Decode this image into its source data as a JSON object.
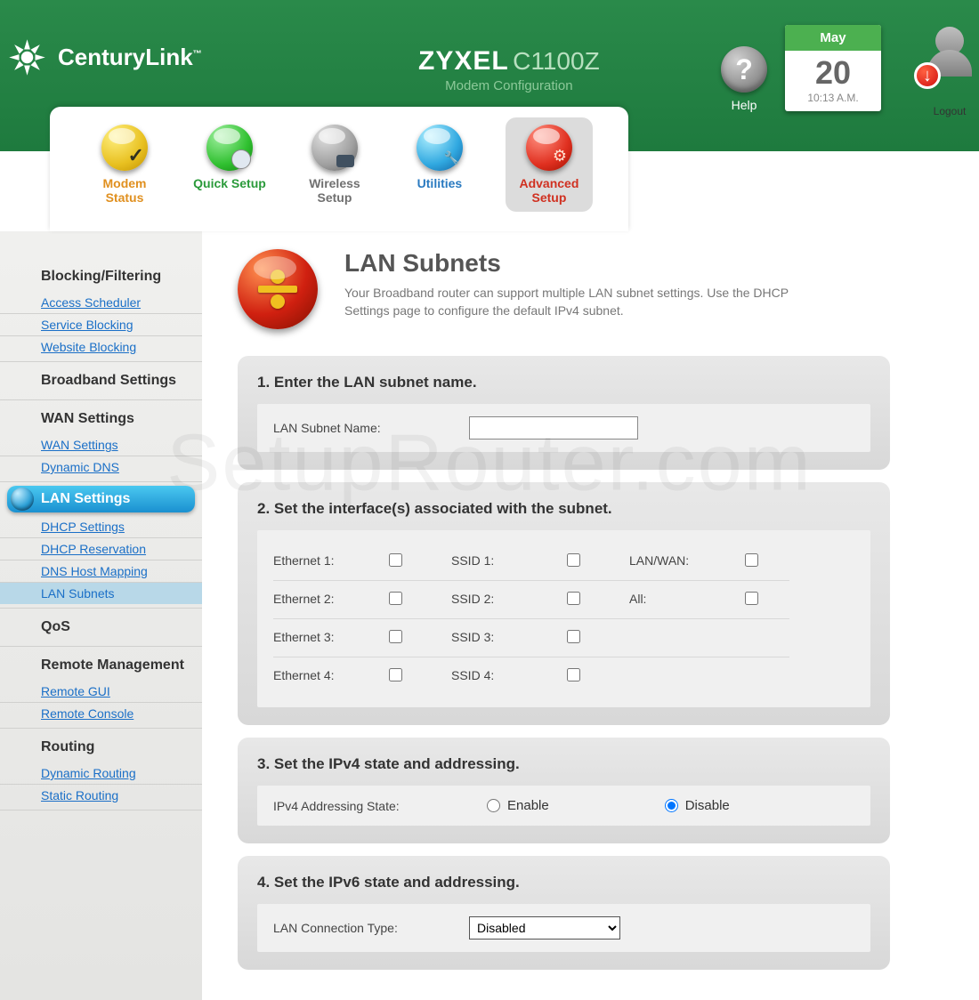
{
  "brand": {
    "name": "CenturyLink",
    "tm": "™"
  },
  "device": {
    "make": "ZYXEL",
    "model": "C1100Z",
    "subtitle": "Modem Configuration"
  },
  "header": {
    "help": "Help",
    "logout": "Logout",
    "date_month": "May",
    "date_day": "20",
    "date_time": "10:13 A.M."
  },
  "nav": {
    "modem_status": "Modem Status",
    "quick_setup": "Quick Setup",
    "wireless_setup": "Wireless Setup",
    "utilities": "Utilities",
    "advanced_setup": "Advanced Setup"
  },
  "sidebar": {
    "blocking": {
      "title": "Blocking/Filtering",
      "access": "Access Scheduler",
      "service": "Service Blocking",
      "website": "Website Blocking"
    },
    "broadband": {
      "title": "Broadband Settings"
    },
    "wan": {
      "title": "WAN Settings",
      "wan_settings": "WAN Settings",
      "ddns": "Dynamic DNS"
    },
    "lan": {
      "title": "LAN Settings",
      "dhcp": "DHCP Settings",
      "dhcp_res": "DHCP Reservation",
      "dns_host": "DNS Host Mapping",
      "subnets": "LAN Subnets"
    },
    "qos": {
      "title": "QoS"
    },
    "remote": {
      "title": "Remote Management",
      "gui": "Remote GUI",
      "console": "Remote Console"
    },
    "routing": {
      "title": "Routing",
      "dynamic": "Dynamic Routing",
      "static": "Static Routing"
    }
  },
  "page": {
    "title": "LAN Subnets",
    "desc": "Your Broadband router can support multiple LAN subnet settings. Use the DHCP Settings page to configure the default IPv4 subnet."
  },
  "step1": {
    "title": "1. Enter the LAN subnet name.",
    "label": "LAN Subnet Name:",
    "value": ""
  },
  "step2": {
    "title": "2. Set the interface(s) associated with the subnet.",
    "eth1": "Ethernet 1:",
    "eth2": "Ethernet 2:",
    "eth3": "Ethernet 3:",
    "eth4": "Ethernet 4:",
    "ssid1": "SSID 1:",
    "ssid2": "SSID 2:",
    "ssid3": "SSID 3:",
    "ssid4": "SSID 4:",
    "lanwan": "LAN/WAN:",
    "all": "All:"
  },
  "step3": {
    "title": "3. Set the IPv4 state and addressing.",
    "label": "IPv4 Addressing State:",
    "enable": "Enable",
    "disable": "Disable"
  },
  "step4": {
    "title": "4. Set the IPv6 state and addressing.",
    "label": "LAN Connection Type:",
    "selected": "Disabled"
  },
  "watermark": "SetupRouter.com"
}
